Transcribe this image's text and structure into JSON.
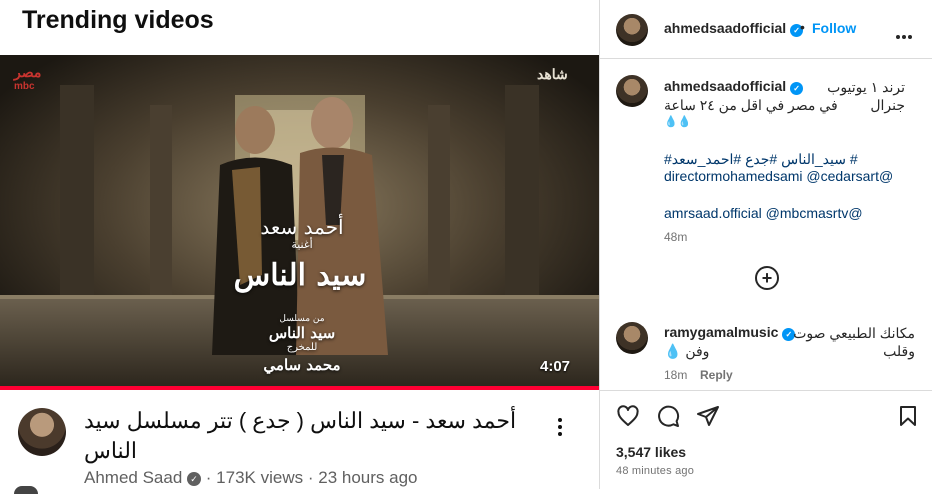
{
  "youtube": {
    "section_title": "Trending videos",
    "video": {
      "duration": "4:07",
      "title": "أحمد سعد - سيد الناس ( جدع ) تتر مسلسل سيد الناس",
      "channel": "Ahmed Saad",
      "views": "173K views",
      "age": "23 hours ago",
      "separator": "·"
    },
    "thumbnail": {
      "network_label": "mbc",
      "network_logo": "مصر",
      "platform_logo": "شاهد",
      "overlay_artist": "أحمد سعد",
      "overlay_song_label": "أغنية",
      "overlay_song": "سيد الناس",
      "overlay_series_prefix": "من مسلسل",
      "overlay_series": "سيد الناس",
      "overlay_director_label": "للمخرج",
      "overlay_director": "محمد سامي"
    }
  },
  "instagram": {
    "header": {
      "username": "ahmedsaadofficial",
      "follow_label": "Follow",
      "separator": "•"
    },
    "caption": {
      "username": "ahmedsaadofficial",
      "line1": "ترند ١ يوتيوب جنرال",
      "line2": "في مصر في اقل من ٢٤ ساعة",
      "line3": "💧💧",
      "hashtags": "#سيد_الناس #جدع #احمد_سعد #",
      "mentions1": "directormohamedsami @cedarsart@",
      "mentions2": "amrsaad.official @mbcmasrtv@",
      "age": "48m"
    },
    "comment": {
      "username": "ramygamalmusic",
      "text1": "مكانك الطبيعي صوت وقلب",
      "text2": "وفن 💧",
      "age": "18m",
      "reply_label": "Reply"
    },
    "likes": "3,547 likes",
    "posted": "48 minutes ago"
  }
}
